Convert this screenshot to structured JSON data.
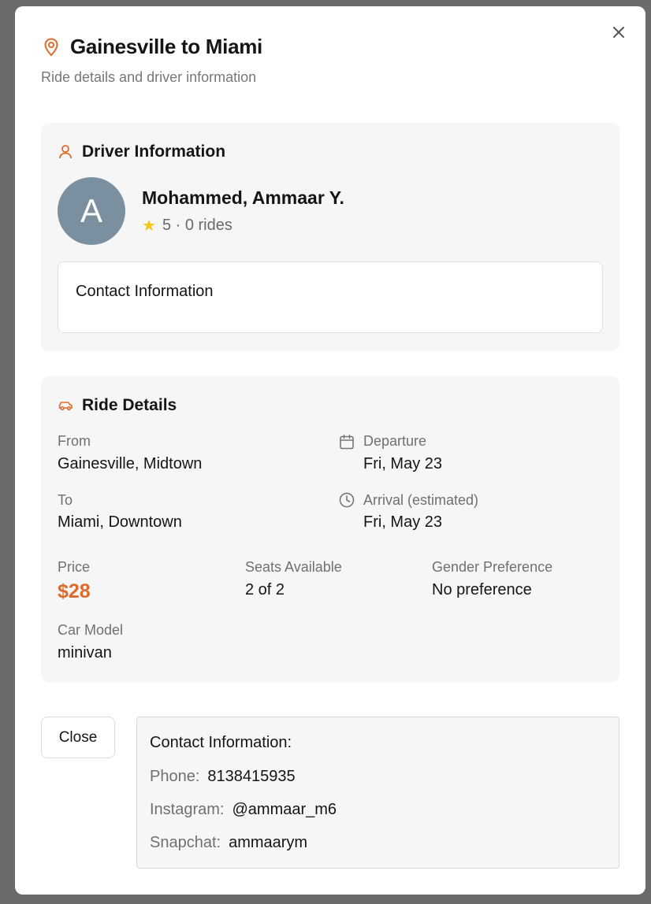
{
  "modal": {
    "title": "Gainesville to Miami",
    "subtitle": "Ride details and driver information"
  },
  "driver": {
    "heading": "Driver Information",
    "avatar_initial": "A",
    "name": "Mohammed, Ammaar Y.",
    "rating": "5 · 0 rides",
    "contact_heading": "Contact Information"
  },
  "ride": {
    "heading": "Ride Details",
    "from_label": "From",
    "from_value": "Gainesville, Midtown",
    "to_label": "To",
    "to_value": "Miami, Downtown",
    "departure_label": "Departure",
    "departure_value": "Fri, May 23",
    "arrival_label": "Arrival (estimated)",
    "arrival_value": "Fri, May 23",
    "price_label": "Price",
    "price_value": "$28",
    "seats_label": "Seats Available",
    "seats_value": "2 of 2",
    "gender_label": "Gender Preference",
    "gender_value": "No preference",
    "car_label": "Car Model",
    "car_value": "minivan"
  },
  "footer": {
    "close_label": "Close"
  },
  "contact_panel": {
    "title": "Contact Information:",
    "phone_label": "Phone:",
    "phone_value": "8138415935",
    "instagram_label": "Instagram:",
    "instagram_value": "@ammaar_m6",
    "snapchat_label": "Snapchat:",
    "snapchat_value": "ammaarym"
  },
  "colors": {
    "accent": "#e06a2c",
    "star": "#f5c518",
    "avatar_bg": "#7a8fa0"
  },
  "icons": [
    "map-pin-icon",
    "close-icon",
    "user-icon",
    "car-icon",
    "calendar-icon",
    "clock-icon",
    "star-icon"
  ]
}
